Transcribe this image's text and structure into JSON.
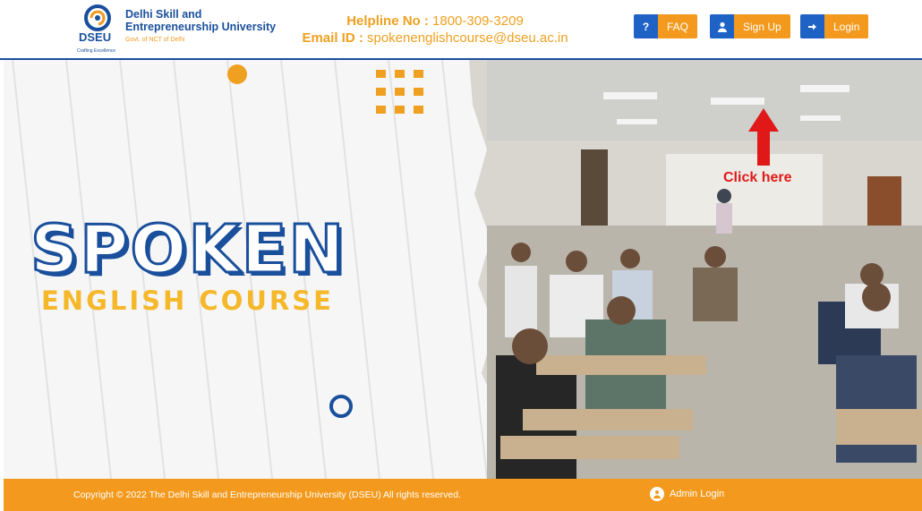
{
  "header": {
    "logo": {
      "icon": "dseu-swirl-logo",
      "abbr": "DSEU",
      "tagline": "Crafting Excellence",
      "name_line1": "Delhi Skill and",
      "name_line2": "Entrepreneurship University",
      "sub": "Govt. of NCT of Delhi"
    },
    "helpline_label": "Helpline No :",
    "helpline_value": "1800-309-3209",
    "email_label": "Email ID :",
    "email_value": "spokenenglishcourse@dseu.ac.in",
    "buttons": {
      "faq": {
        "icon": "question-icon",
        "label": "FAQ"
      },
      "signup": {
        "icon": "user-icon",
        "label": "Sign Up"
      },
      "login": {
        "icon": "login-icon",
        "label": "Login"
      }
    }
  },
  "banner": {
    "title": "SPOKEN",
    "subtitle": "ENGLISH COURSE",
    "annotation": "Click here",
    "photo": "classroom-students-photo"
  },
  "footer": {
    "copyright": "Copyright © 2022 The Delhi Skill and Entrepreneurship University (DSEU) All rights reserved.",
    "admin_login": "Admin Login",
    "admin_icon": "user-circle-icon"
  },
  "colors": {
    "brand_blue": "#1a4f9c",
    "accent_orange": "#f39a1e",
    "button_blue": "#1f62c6",
    "annotation_red": "#e01818"
  }
}
